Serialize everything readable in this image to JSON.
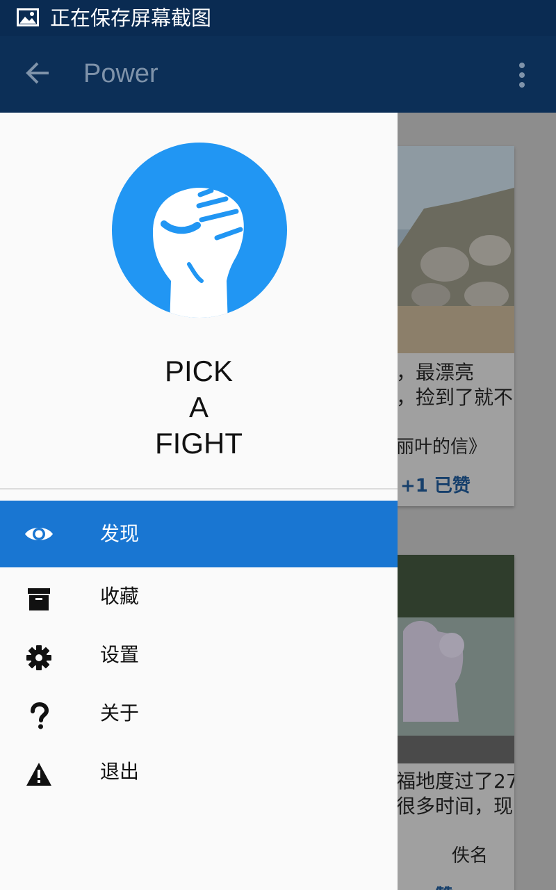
{
  "status_bar": {
    "icon": "image-icon",
    "text": "正在保存屏幕截图"
  },
  "app_bar": {
    "back_icon": "arrow-back-icon",
    "title": "Power",
    "more_icon": "more-vert-icon"
  },
  "drawer": {
    "brand_lines": [
      "PICK",
      "A",
      "FIGHT"
    ],
    "logo_icon": "raised-fist-icon",
    "accent_color": "#1976d2",
    "logo_color": "#2196f3",
    "items": [
      {
        "label": "发现",
        "icon": "eye-icon",
        "active": true
      },
      {
        "label": "收藏",
        "icon": "archive-icon",
        "active": false
      },
      {
        "label": "设置",
        "icon": "gear-icon",
        "active": false
      },
      {
        "label": "关于",
        "icon": "help-icon",
        "active": false
      },
      {
        "label": "退出",
        "icon": "warning-icon",
        "active": false
      }
    ]
  },
  "feed": {
    "cards": [
      {
        "title_line1": "，最漂亮",
        "title_line2": "，捡到了就不",
        "meta": "丽叶的信》",
        "likes": "+1 已赞"
      },
      {
        "title_line1": "福地度过了27",
        "title_line2": "很多时间，现",
        "meta": "佚名",
        "likes": "赞"
      }
    ]
  }
}
